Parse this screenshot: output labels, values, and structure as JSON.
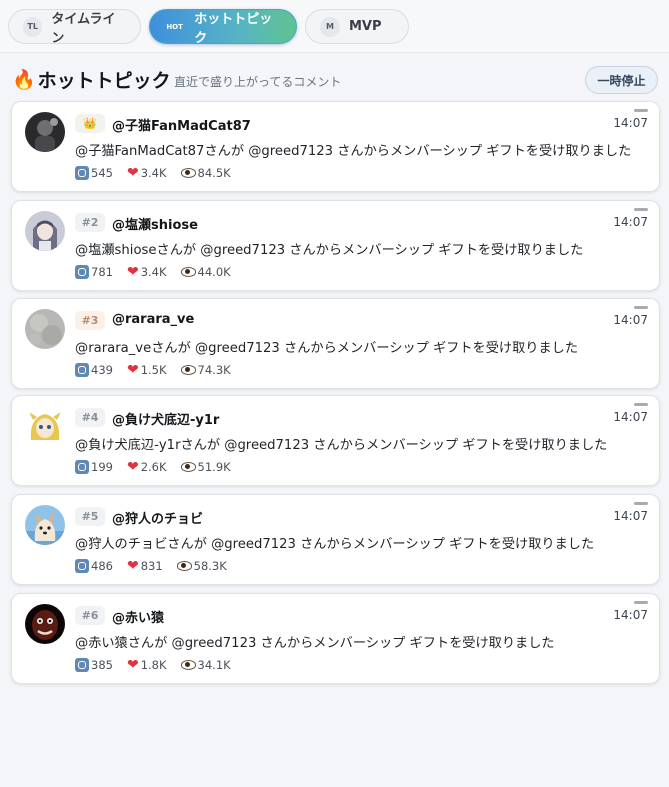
{
  "tabs": [
    {
      "badge": "TL",
      "label": "タイムライン",
      "active": false
    },
    {
      "badge": "HOT",
      "label": "ホットトピック",
      "active": true
    },
    {
      "badge": "M",
      "label": "MVP",
      "active": false
    }
  ],
  "section": {
    "icon": "🔥",
    "title": "ホットトピック",
    "subtitle": "直近で盛り上がってるコメント",
    "pause_label": "一時停止"
  },
  "posts": [
    {
      "rank": "👑",
      "user": "@子猫FanMadCat87",
      "time": "14:07",
      "message": "@子猫FanMadCat87さんが @greed7123 さんからメンバーシップ ギフトを受け取りました",
      "retweets": "545",
      "likes": "3.4K",
      "views": "84.5K",
      "avatar": "avatar-dark-figure"
    },
    {
      "rank": "#2",
      "user": "@塩瀬shiose",
      "time": "14:07",
      "message": "@塩瀬shioseさんが @greed7123 さんからメンバーシップ ギフトを受け取りました",
      "retweets": "781",
      "likes": "3.4K",
      "views": "44.0K",
      "avatar": "avatar-anime-girl"
    },
    {
      "rank": "#3",
      "user": "@rarara_ve",
      "time": "14:07",
      "message": "@rarara_veさんが @greed7123 さんからメンバーシップ ギフトを受け取りました",
      "retweets": "439",
      "likes": "1.5K",
      "views": "74.3K",
      "avatar": "avatar-gray-texture"
    },
    {
      "rank": "#4",
      "user": "@負け犬底辺-y1r",
      "time": "14:07",
      "message": "@負け犬底辺-y1rさんが @greed7123 さんからメンバーシップ ギフトを受け取りました",
      "retweets": "199",
      "likes": "2.6K",
      "views": "51.9K",
      "avatar": "avatar-blonde-character"
    },
    {
      "rank": "#5",
      "user": "@狩人のチョビ",
      "time": "14:07",
      "message": "@狩人のチョビさんが @greed7123 さんからメンバーシップ ギフトを受け取りました",
      "retweets": "486",
      "likes": "831",
      "views": "58.3K",
      "avatar": "avatar-shiba-dog"
    },
    {
      "rank": "#6",
      "user": "@赤い猿",
      "time": "14:07",
      "message": "@赤い猿さんが @greed7123 さんからメンバーシップ ギフトを受け取りました",
      "retweets": "385",
      "likes": "1.8K",
      "views": "34.1K",
      "avatar": "avatar-red-face"
    }
  ]
}
